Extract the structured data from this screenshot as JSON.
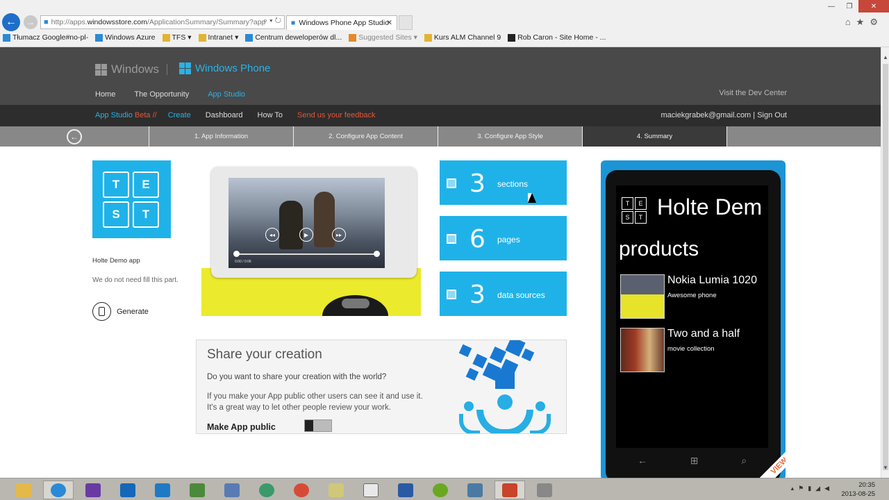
{
  "browser": {
    "url_prefix": "http://apps.",
    "url_domain": "windowsstore.com",
    "url_rest": "/ApplicationSummary/Summary?app",
    "tab_title": "Windows Phone App Studio",
    "favorites": [
      "Tłumacz Google#no-pl-",
      "Windows Azure",
      "TFS ▾",
      "Intranet ▾",
      "Centrum deweloperów dl...",
      "Suggested Sites ▾",
      "Kurs ALM  Channel 9",
      "Rob Caron - Site Home - ..."
    ]
  },
  "header": {
    "windows_logo": "Windows",
    "windows_phone_logo": "Windows Phone",
    "nav": [
      "Home",
      "The Opportunity",
      "App Studio"
    ],
    "dev_center": "Visit the Dev Center"
  },
  "subnav": {
    "brand": "App Studio",
    "beta": "Beta //",
    "create": "Create",
    "dashboard": "Dashboard",
    "howto": "How To",
    "feedback": "Send us your feedback",
    "account": "maciekgrabek@gmail.com  | Sign Out"
  },
  "steps": [
    "1. App Information",
    "2. Configure App Content",
    "3. Configure App Style",
    "4. Summary"
  ],
  "app": {
    "tile_letters": [
      "T",
      "E",
      "S",
      "T"
    ],
    "name": "Holte Demo app",
    "description": "We do not need fill this part.",
    "generate": "Generate"
  },
  "lumia": {
    "time": "0:00 / 0:06"
  },
  "stats": [
    {
      "value": "3",
      "label": "sections"
    },
    {
      "value": "6",
      "label": "pages"
    },
    {
      "value": "3",
      "label": "data sources"
    }
  ],
  "share": {
    "title": "Share your creation",
    "question": "Do you want to share your creation with the world?",
    "desc1": "If you make your App public other users can see it and use it.",
    "desc2": "It's a great way to let other people review your work.",
    "make_public": "Make App public"
  },
  "phone": {
    "title": "Holte Dem",
    "section": "products",
    "items": [
      {
        "name": "Nokia Lumia 1020",
        "sub": "Awesome phone"
      },
      {
        "name": "Two and a half",
        "sub": "movie collection"
      }
    ],
    "ribbon": "VIEW"
  },
  "taskbar": {
    "time": "20:35",
    "date": "2013-08-25"
  },
  "colors": {
    "accent": "#1fb2e8",
    "header": "#494949",
    "subnav": "#2d2d2d",
    "feedback": "#e2573b"
  }
}
